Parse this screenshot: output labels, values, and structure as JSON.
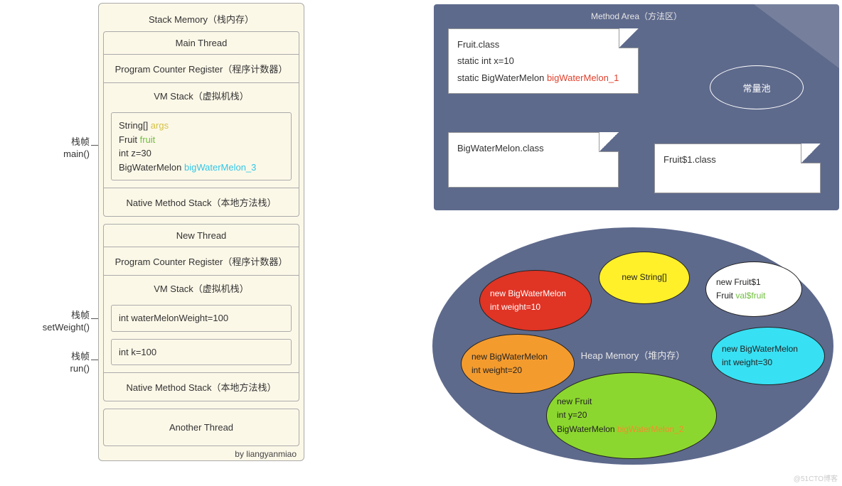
{
  "stack": {
    "title": "Stack Memory（栈内存）",
    "credit": "by liangyanmiao",
    "threads": [
      {
        "title": "Main Thread",
        "pcr": "Program Counter Register（程序计数器）",
        "vm_label": "VM Stack（虚拟机栈）",
        "nms": "Native Method Stack（本地方法栈）",
        "frames": [
          {
            "label_lines": [
              "栈帧",
              "main()"
            ],
            "lines": [
              {
                "pre": "String[] ",
                "var": "args",
                "cls": "c-yellow"
              },
              {
                "pre": "Fruit ",
                "var": "fruit",
                "cls": "c-green"
              },
              {
                "pre": "int z=30"
              },
              {
                "pre": "BigWaterMelon ",
                "var": "bigWaterMelon_3",
                "cls": "c-cyan"
              }
            ]
          }
        ]
      },
      {
        "title": "New Thread",
        "pcr": "Program Counter Register（程序计数器）",
        "vm_label": "VM Stack（虚拟机栈）",
        "nms": "Native Method Stack（本地方法栈）",
        "frames": [
          {
            "label_lines": [
              "栈帧",
              "setWeight()"
            ],
            "lines": [
              {
                "pre": "int waterMelonWeight=100"
              }
            ]
          },
          {
            "label_lines": [
              "栈帧",
              "run()"
            ],
            "lines": [
              {
                "pre": "int k=100"
              }
            ]
          }
        ]
      }
    ],
    "another": "Another Thread"
  },
  "method_area": {
    "title": "Method Area（方法区）",
    "constant_pool": "常量池",
    "docs": {
      "fruit": {
        "l1": "Fruit.class",
        "l2": "static int x=10",
        "l3_pre": "static BigWaterMelon ",
        "l3_var": "bigWaterMelon_1"
      },
      "bwm": {
        "l1": "BigWaterMelon.class"
      },
      "fruit1": {
        "l1": "Fruit$1.class"
      }
    }
  },
  "heap": {
    "title": "Heap Memory（堆内存）",
    "objs": {
      "red": {
        "l1": "new BigWaterMelon",
        "l2": "int weight=10"
      },
      "yellow": {
        "l1": "new String[]"
      },
      "white": {
        "l1": "new Fruit$1",
        "l2_pre": "Fruit ",
        "l2_var": "val$fruit"
      },
      "orange": {
        "l1": "new BigWaterMelon",
        "l2": "int weight=20"
      },
      "cyan": {
        "l1": "new BigWaterMelon",
        "l2": "int weight=30"
      },
      "green": {
        "l1": "new Fruit",
        "l2": "int y=20",
        "l3_pre": "BigWaterMelon ",
        "l3_var": "bigWaterMelon_2"
      }
    }
  },
  "watermark": "@51CTO博客"
}
